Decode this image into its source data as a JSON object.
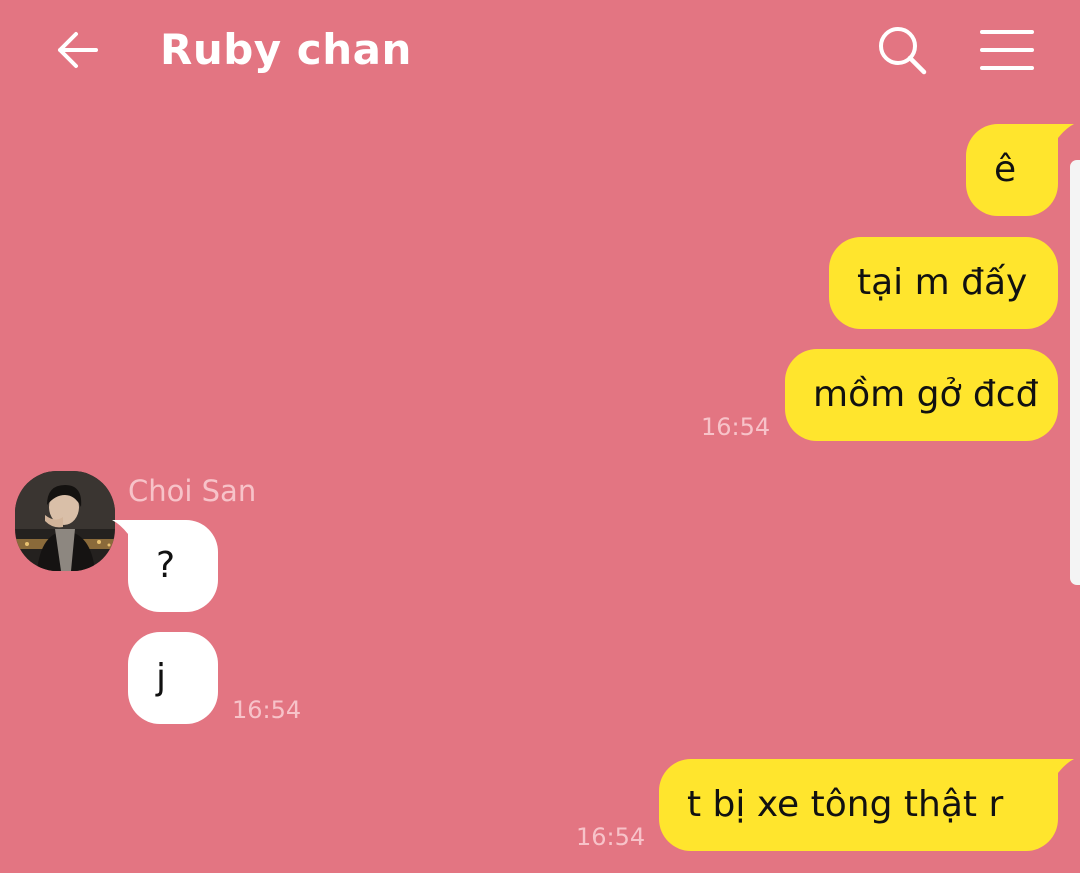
{
  "header": {
    "title": "Ruby chan",
    "back_icon": "arrow-left-icon",
    "search_icon": "search-icon",
    "menu_icon": "hamburger-menu-icon"
  },
  "messages": [
    {
      "side": "out",
      "text": "ê"
    },
    {
      "side": "out",
      "text": "tại m đấy"
    },
    {
      "side": "out",
      "text": "mồm gở đcđ",
      "time": "16:54"
    },
    {
      "side": "in",
      "sender": "Choi San",
      "text": "?"
    },
    {
      "side": "in",
      "text": "j",
      "time": "16:54"
    },
    {
      "side": "out",
      "text": "t bị xe tông thật r",
      "time": "16:54"
    }
  ],
  "colors": {
    "background": "#e37582",
    "outgoing_bubble": "#ffe52d",
    "incoming_bubble": "#ffffff",
    "muted_text": "#f7c3c9"
  }
}
